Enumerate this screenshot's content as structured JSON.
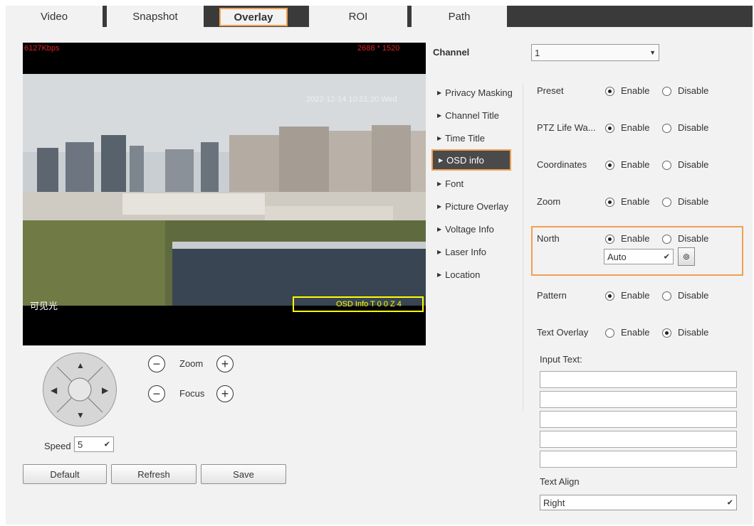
{
  "tabs": [
    {
      "label": "Video"
    },
    {
      "label": "Snapshot"
    },
    {
      "label": "Overlay"
    },
    {
      "label": "ROI"
    },
    {
      "label": "Path"
    }
  ],
  "video": {
    "bitrate": "6127Kbps",
    "resolution": "2688 * 1520",
    "timestamp": "2022-12-14 10:51:20 Wed",
    "channel_label": "可见光",
    "osd_box": "OSD Info T 0 0 Z 4"
  },
  "ptz": {
    "zoom_label": "Zoom",
    "focus_label": "Focus",
    "speed_label": "Speed",
    "speed_value": "5"
  },
  "buttons": {
    "default": "Default",
    "refresh": "Refresh",
    "save": "Save"
  },
  "channel": {
    "label": "Channel",
    "value": "1"
  },
  "nav": [
    {
      "label": "Privacy Masking"
    },
    {
      "label": "Channel Title"
    },
    {
      "label": "Time Title"
    },
    {
      "label": "OSD info"
    },
    {
      "label": "Font"
    },
    {
      "label": "Picture Overlay"
    },
    {
      "label": "Voltage Info"
    },
    {
      "label": "Laser Info"
    },
    {
      "label": "Location"
    }
  ],
  "options": {
    "enable": "Enable",
    "disable": "Disable"
  },
  "settings": [
    {
      "label": "Preset",
      "value": "Enable"
    },
    {
      "label": "PTZ Life Wa...",
      "value": "Enable"
    },
    {
      "label": "Coordinates",
      "value": "Enable"
    },
    {
      "label": "Zoom",
      "value": "Enable"
    },
    {
      "label": "North",
      "value": "Enable"
    },
    {
      "label": "Pattern",
      "value": "Enable"
    },
    {
      "label": "Text Overlay",
      "value": "Disable"
    }
  ],
  "north": {
    "mode": "Auto"
  },
  "input_text_label": "Input Text:",
  "text_align": {
    "label": "Text Align",
    "value": "Right"
  },
  "colors": {
    "accent": "#f0a050",
    "tabbar": "#3a3a3a"
  }
}
